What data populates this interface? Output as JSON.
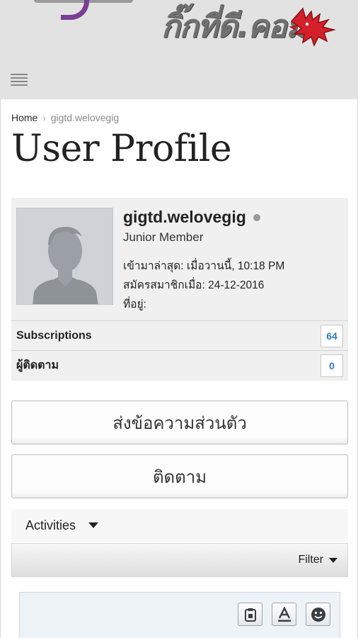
{
  "header": {
    "logo_text": "กิ๊กที่ดี.คอม",
    "menu_icon": "hamburger-menu-icon"
  },
  "breadcrumb": {
    "home": "Home",
    "separator_icon": "chevron-right-icon",
    "current": "gigtd.welovegig"
  },
  "page": {
    "title": "User Profile"
  },
  "profile": {
    "username": "gigtd.welovegig",
    "status_color": "#9a9a9a",
    "rank": "Junior Member",
    "last_visit": "เข้ามาล่าสุด: เมื่อวานนี้, 10:18 PM",
    "join_date": "สมัครสมาชิกเมื่อ: 24-12-2016",
    "location": "ที่อยู่:",
    "stats": [
      {
        "label": "Subscriptions",
        "count": "64"
      },
      {
        "label": "ผู้ติดตาม",
        "count": "0"
      }
    ]
  },
  "actions": {
    "send_message": "ส่งข้อความส่วนตัว",
    "follow": "ติดตาม"
  },
  "activities": {
    "tab_label": "Activities",
    "filter_label": "Filter"
  },
  "colors": {
    "header_bg": "#e2e2e2",
    "count_text": "#2f7bbf",
    "logo_accent": "#d3202a"
  }
}
